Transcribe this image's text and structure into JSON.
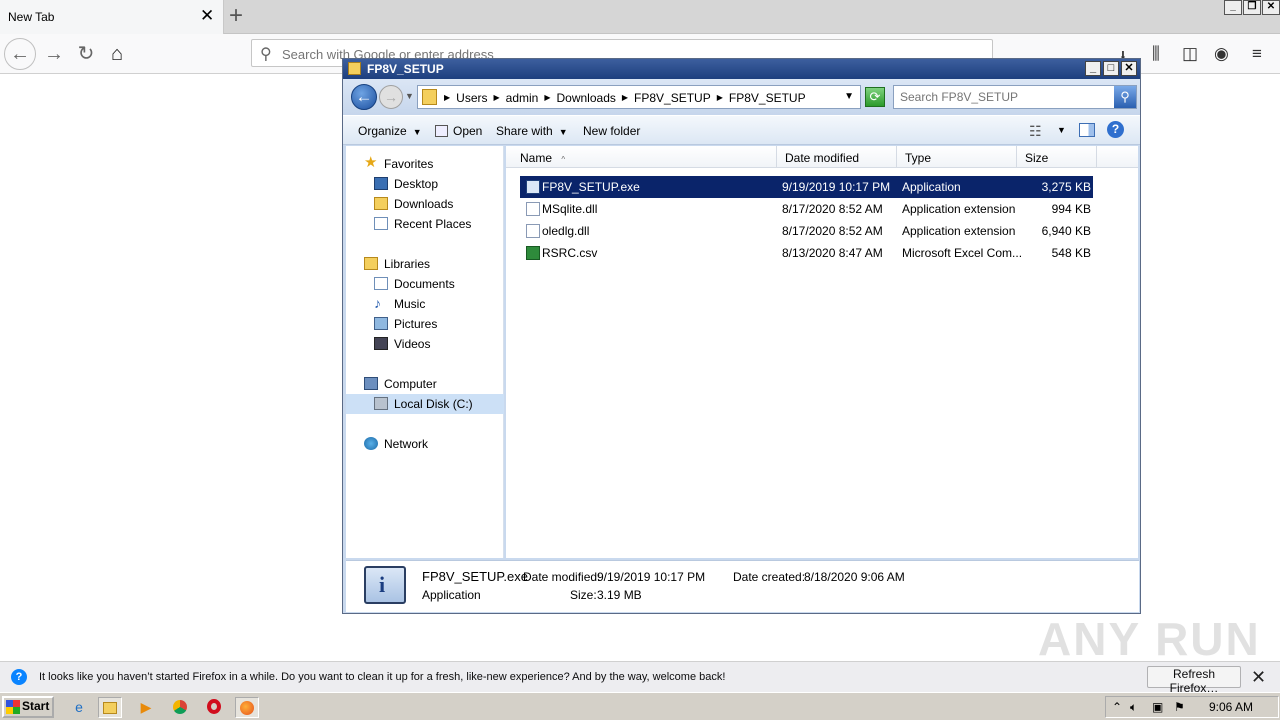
{
  "firefox": {
    "tab_title": "New Tab",
    "tab_close": "✕",
    "new_tab": "+",
    "url_placeholder": "Search with Google or enter address",
    "window_controls": [
      "_",
      "❐",
      "✕"
    ]
  },
  "explorer": {
    "title": "FP8V_SETUP",
    "title_buttons": [
      "_",
      "□",
      "✕"
    ],
    "breadcrumbs": [
      "Users",
      "admin",
      "Downloads",
      "FP8V_SETUP",
      "FP8V_SETUP"
    ],
    "search_placeholder": "Search FP8V_SETUP",
    "toolbar": {
      "organize": "Organize",
      "open": "Open",
      "share_with": "Share with",
      "new_folder": "New folder",
      "help": "?"
    },
    "nav": {
      "favorites": "Favorites",
      "desktop": "Desktop",
      "downloads": "Downloads",
      "recent_places": "Recent Places",
      "libraries": "Libraries",
      "documents": "Documents",
      "music": "Music",
      "pictures": "Pictures",
      "videos": "Videos",
      "computer": "Computer",
      "local_disk": "Local Disk (C:)",
      "network": "Network"
    },
    "columns": {
      "name": "Name",
      "date_modified": "Date modified",
      "type": "Type",
      "size": "Size",
      "sort_indicator": "^"
    },
    "files": [
      {
        "name": "FP8V_SETUP.exe",
        "date": "9/19/2019 10:17 PM",
        "type": "Application",
        "size": "3,275 KB",
        "icon": "exe-icon"
      },
      {
        "name": "MSqlite.dll",
        "date": "8/17/2020 8:52 AM",
        "type": "Application extension",
        "size": "994 KB",
        "icon": "dll-icon"
      },
      {
        "name": "oledlg.dll",
        "date": "8/17/2020 8:52 AM",
        "type": "Application extension",
        "size": "6,940 KB",
        "icon": "dll-icon"
      },
      {
        "name": "RSRC.csv",
        "date": "8/13/2020 8:47 AM",
        "type": "Microsoft Excel Com...",
        "size": "548 KB",
        "icon": "excel-csv-icon"
      }
    ],
    "details": {
      "filename": "FP8V_SETUP.exe",
      "type": "Application",
      "date_modified_label": "Date modified:",
      "date_modified": "9/19/2019 10:17 PM",
      "date_created_label": "Date created:",
      "date_created": "8/18/2020 9:06 AM",
      "size_label": "Size:",
      "size": "3.19 MB"
    }
  },
  "notification": {
    "text": "It looks like you haven’t started Firefox in a while. Do you want to clean it up for a fresh, like-new experience? And by the way, welcome back!",
    "button": "Refresh Firefox…",
    "close": "✕"
  },
  "watermark": "ANY RUN",
  "taskbar": {
    "start": "Start",
    "clock": "9:06 AM"
  },
  "colors": {
    "selection": "#0a246a",
    "titlebar": "#1d3f7e",
    "notif_icon": "#0a84ff"
  }
}
